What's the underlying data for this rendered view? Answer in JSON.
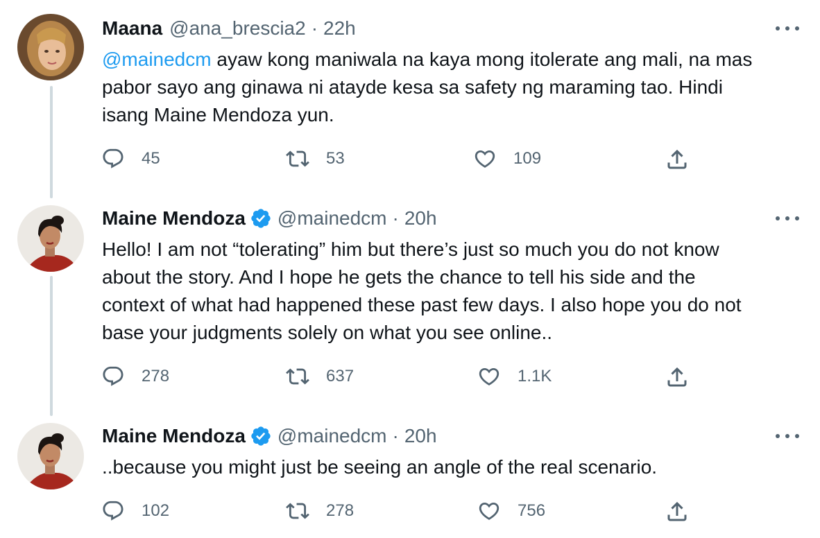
{
  "tweets": [
    {
      "name": "Maana",
      "handle": "@ana_brescia2",
      "separator": "·",
      "time": "22h",
      "verified": false,
      "text_mention": "@mainedcm",
      "text_line_1": " ayaw kong maniwala na kaya mong itolerate ang mali, na mas",
      "text_line_2": "pabor sayo ang ginawa ni atayde kesa sa safety ng maraming tao. Hindi",
      "text_line_3": "isang Maine Mendoza yun.",
      "text_line_4": "",
      "replies": "45",
      "retweets": "53",
      "likes": "109"
    },
    {
      "name": "Maine Mendoza",
      "handle": "@mainedcm",
      "separator": "·",
      "time": "20h",
      "verified": true,
      "text_mention": "",
      "text_line_1": "Hello! I am not “tolerating” him but there’s just so much you do not know",
      "text_line_2": "about the story. And I hope he gets the chance to tell his side and the",
      "text_line_3": "context of what had happened these past few days. I also hope you do not",
      "text_line_4": "base your judgments solely on what you see online..",
      "replies": "278",
      "retweets": "637",
      "likes": "1.1K"
    },
    {
      "name": "Maine Mendoza",
      "handle": "@mainedcm",
      "separator": "·",
      "time": "20h",
      "verified": true,
      "text_mention": "",
      "text_line_1": "..because you might just be seeing an angle of the real scenario.",
      "text_line_2": "",
      "text_line_3": "",
      "text_line_4": "",
      "replies": "102",
      "retweets": "278",
      "likes": "756"
    }
  ],
  "icons": {
    "reply": "reply-icon",
    "retweet": "retweet-icon",
    "like": "like-icon",
    "share": "share-icon",
    "more": "more-icon",
    "verified": "verified-badge-icon"
  },
  "colors": {
    "mention": "#1d9bf0",
    "verified": "#1d9bf0",
    "secondary_text": "#536471",
    "thread_line": "#cfd9de"
  }
}
